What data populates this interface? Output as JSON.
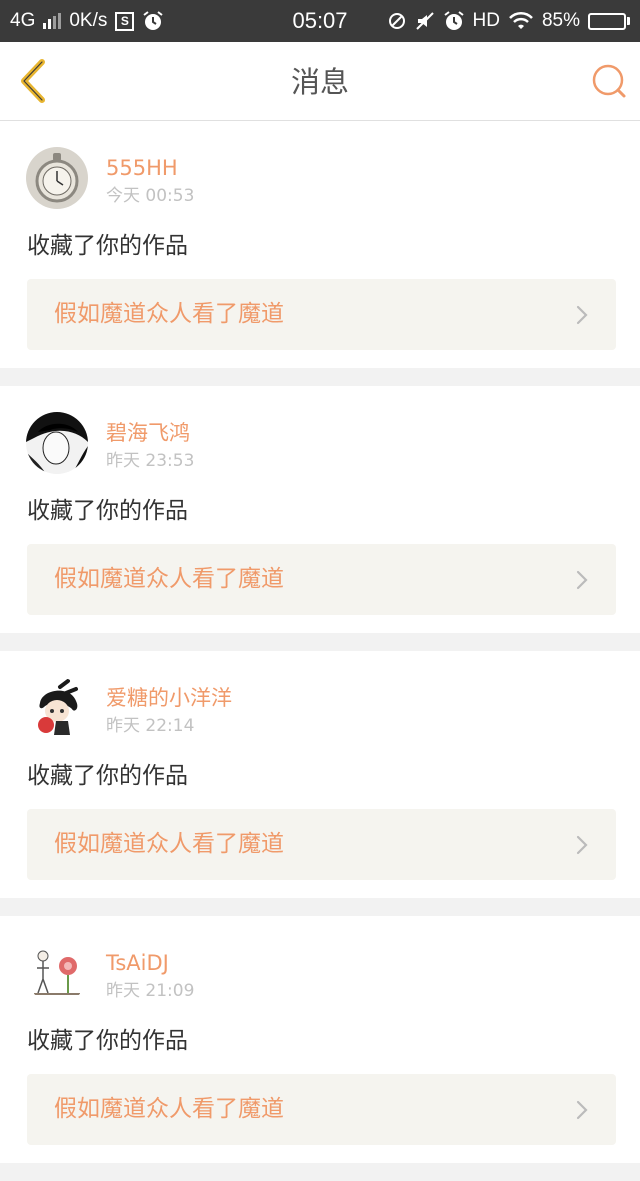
{
  "status_bar": {
    "network": "4G",
    "speed": "0K/s",
    "s_badge": "S",
    "time": "05:07",
    "hd": "HD",
    "battery": "85%",
    "battery_level": 0.85,
    "icons": [
      "alarm-icon",
      "data-sync-icon",
      "mute-icon",
      "alarm-icon",
      "wifi-icon",
      "battery-icon"
    ]
  },
  "header": {
    "title": "消息",
    "back_icon": "chevron-left-icon",
    "search_icon": "search-icon"
  },
  "colors": {
    "accent": "#f09a6a",
    "back_arrow": "#e8b530",
    "search": "#f09a6a",
    "muted": "#c2c2c2"
  },
  "messages": [
    {
      "user": "555HH",
      "time": "今天 00:53",
      "action": "收藏了你的作品",
      "work": "假如魔道众人看了魔道"
    },
    {
      "user": "碧海飞鸿",
      "time": "昨天 23:53",
      "action": "收藏了你的作品",
      "work": "假如魔道众人看了魔道"
    },
    {
      "user": "爱糖的小洋洋",
      "time": "昨天 22:14",
      "action": "收藏了你的作品",
      "work": "假如魔道众人看了魔道"
    },
    {
      "user": "TsAiDJ",
      "time": "昨天 21:09",
      "action": "收藏了你的作品",
      "work": "假如魔道众人看了魔道"
    }
  ]
}
